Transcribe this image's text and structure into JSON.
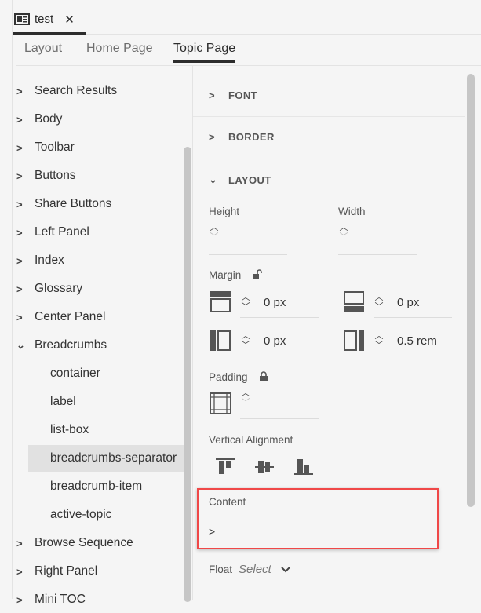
{
  "document_tab": {
    "title": "test",
    "close": "✕"
  },
  "tabs": [
    {
      "label": "Layout"
    },
    {
      "label": "Home Page"
    },
    {
      "label": "Topic Page"
    }
  ],
  "tree": {
    "items": [
      "Search Results",
      "Body",
      "Toolbar",
      "Buttons",
      "Share Buttons",
      "Left Panel",
      "Index",
      "Glossary",
      "Center Panel",
      "Breadcrumbs"
    ],
    "children": [
      "container",
      "label",
      "list-box",
      "breadcrumbs-separator",
      "breadcrumb-item",
      "active-topic"
    ],
    "after": [
      "Browse Sequence",
      "Right Panel",
      "Mini TOC"
    ],
    "selected": "breadcrumbs-separator"
  },
  "properties": {
    "sections": {
      "font": "FONT",
      "border": "BORDER",
      "layout": "LAYOUT"
    },
    "height_label": "Height",
    "width_label": "Width",
    "margin_label": "Margin",
    "margin": {
      "top": "0 px",
      "bottom": "0 px",
      "left": "0 px",
      "right": "0.5 rem"
    },
    "padding_label": "Padding",
    "vertical_alignment_label": "Vertical Alignment",
    "content_label": "Content",
    "content_value": ">",
    "float_label": "Float",
    "float_value": "Select"
  },
  "colors": {
    "highlight": "#f04848",
    "selected_row": "#e1e1e1"
  }
}
